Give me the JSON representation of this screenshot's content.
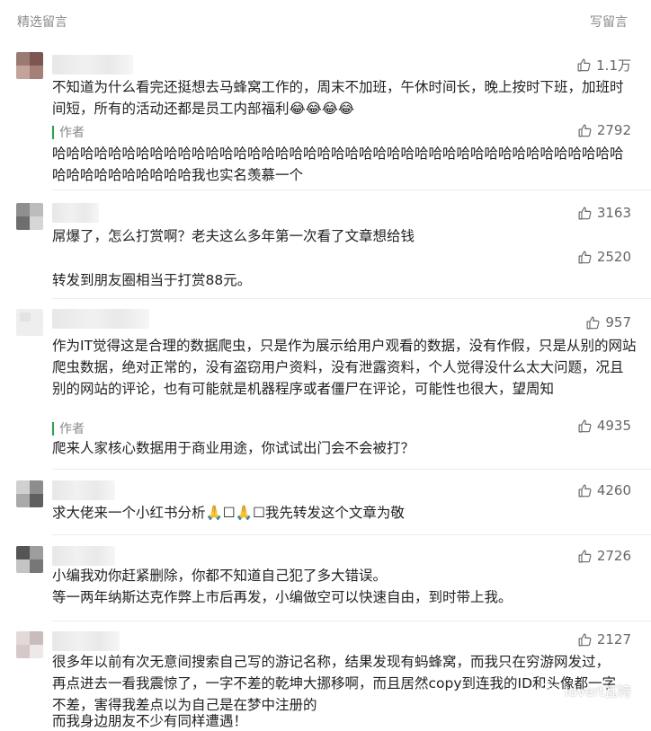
{
  "header": {
    "title": "精选留言",
    "write_label": "写留言"
  },
  "icons": {
    "like": "thumb-up-icon",
    "watermark": "wechat-icon"
  },
  "colors": {
    "author_bar": "#25a84a",
    "muted_text": "#8a8a8a",
    "body_text": "#222222"
  },
  "comments": [
    {
      "likes": "1.1万",
      "text": "不知道为什么看完还挺想去马蜂窝工作的，周末不加班，午休时间长，晚上按时下班，加班时间短，所有的活动还都是员工内部福利😂😂😂😂",
      "author_label": "作者",
      "reply_likes": "2792",
      "reply": "哈哈哈哈哈哈哈哈哈哈哈哈哈哈哈哈哈哈哈哈哈哈哈哈哈哈哈哈哈哈哈哈哈哈哈哈哈哈哈哈哈哈哈哈哈哈哈哈哈哈哈我也实名羡慕一个"
    },
    {
      "likes": "3163",
      "text": "屌爆了，怎么打赏啊？老夫这么多年第一次看了文章想给钱",
      "reply_likes": "2520",
      "reply": "转发到朋友圈相当于打赏88元。"
    },
    {
      "likes": "957",
      "text": "作为IT觉得这是合理的数据爬虫，只是作为展示给用户观看的数据，没有作假，只是从别的网站爬虫数据，绝对正常的，没有盗窃用户资料，没有泄露资料，个人觉得没什么太大问题，况且别的网站的评论，也有可能就是机器程序或者僵尸在评论，可能性也很大，望周知",
      "author_label": "作者",
      "reply_likes": "4935",
      "reply": "爬来人家核心数据用于商业用途，你试试出门会不会被打？"
    },
    {
      "likes": "4260",
      "text": "求大佬来一个小红书分析🙏☐🙏☐我先转发这个文章为敬"
    },
    {
      "likes": "2726",
      "text": "小编我劝你赶紧删除，你都不知道自己犯了多大错误。",
      "text2": "等一两年纳斯达克作弊上市后再发，小编做空可以快速自由，到时带上我。"
    },
    {
      "likes": "2127",
      "text": "很多年以前有次无意间搜索自己写的游记名称，结果发现有蚂蜂窝，而我只在穷游网发过，再点进去一看我震惊了，一字不差的乾坤大挪移啊，而且居然copy到连我的ID和头像都一字不差，害得我差点以为自己是在梦中注册的",
      "text2": "而我身边朋友不少有同样遭遇！"
    }
  ],
  "watermark": {
    "text": "Idvert瓦特"
  }
}
